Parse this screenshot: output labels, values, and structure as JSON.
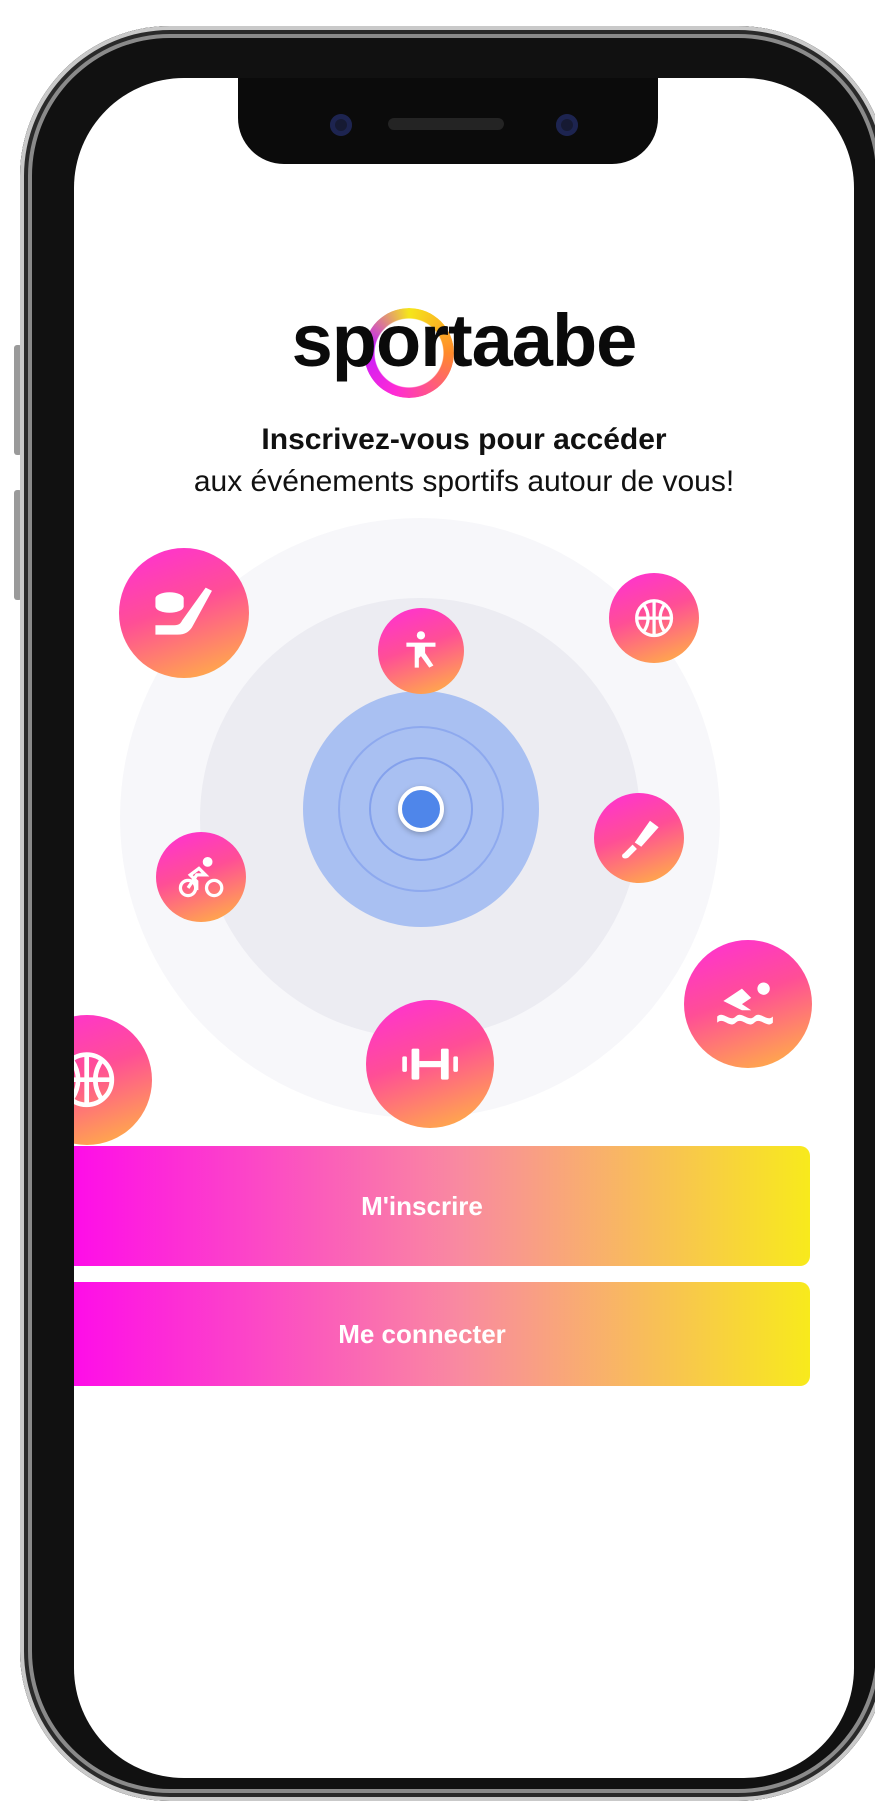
{
  "app": {
    "logo_text": "sportaabe",
    "headline": "Inscrivez-vous pour accéder",
    "subline": "aux événements sportifs autour de vous!"
  },
  "buttons": {
    "signup_label": "M'inscrire",
    "login_label": "Me connecter"
  },
  "sports": [
    {
      "name": "hockey-icon"
    },
    {
      "name": "yoga-icon"
    },
    {
      "name": "basketball-icon"
    },
    {
      "name": "badminton-icon"
    },
    {
      "name": "cycling-icon"
    },
    {
      "name": "swimming-icon"
    },
    {
      "name": "weightlifting-icon"
    },
    {
      "name": "basketball-icon"
    }
  ],
  "colors": {
    "gradient_start": "#ff00f0",
    "gradient_mid": "#f98aa0",
    "gradient_end": "#f8ea1c",
    "location_dot": "#4f86ea"
  }
}
